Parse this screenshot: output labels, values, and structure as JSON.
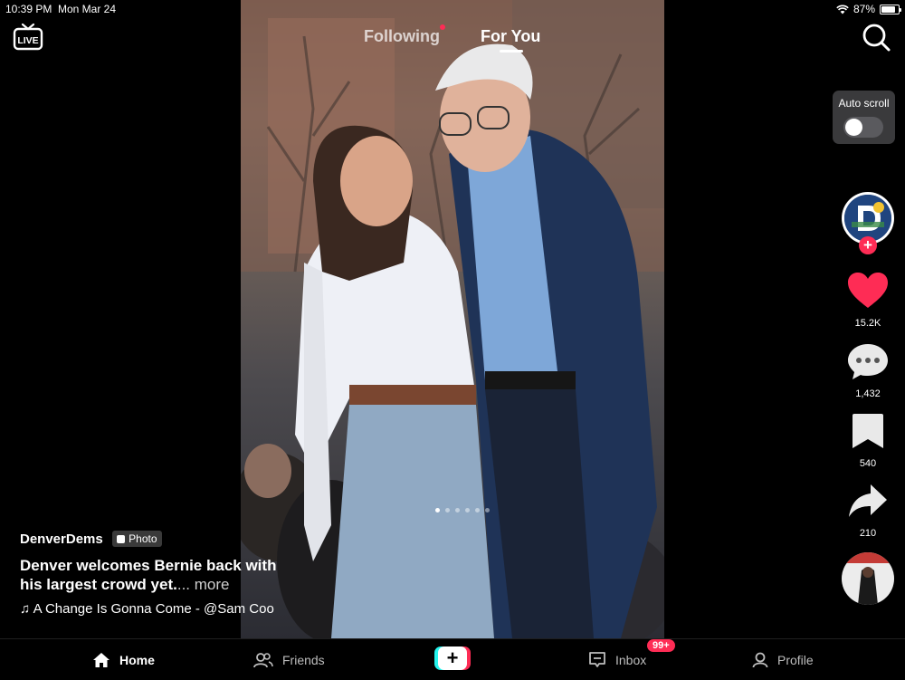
{
  "status_bar": {
    "time": "10:39 PM",
    "date": "Mon Mar 24",
    "battery": "87%"
  },
  "top_tabs": {
    "following": "Following",
    "for_you": "For You"
  },
  "live_label": "LIVE",
  "auto_scroll": {
    "label": "Auto scroll",
    "enabled": false
  },
  "actions": {
    "likes": "15.2K",
    "comments": "1,432",
    "saves": "540",
    "shares": "210"
  },
  "post": {
    "username": "DenverDems",
    "badge": "Photo",
    "description": "Denver welcomes Bernie back with his largest crowd yet.",
    "more": "... more",
    "music": "A Change Is Gonna Come - @Sam Coo",
    "carousel_total": 6,
    "carousel_index": 1
  },
  "bottom_nav": {
    "home": "Home",
    "friends": "Friends",
    "inbox": "Inbox",
    "inbox_badge": "99+",
    "profile": "Profile"
  },
  "colors": {
    "accent": "#fe2c55",
    "cyan": "#25f4ee",
    "like": "#fe2c55"
  }
}
